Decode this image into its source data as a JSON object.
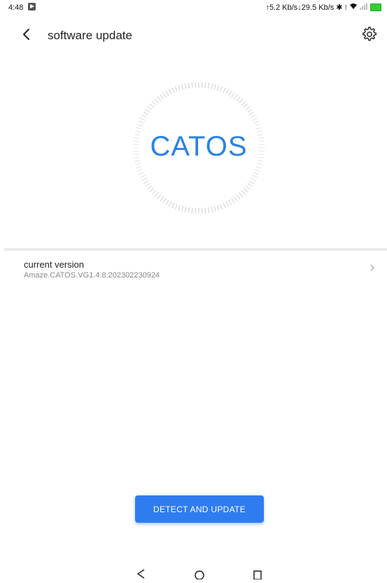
{
  "status_bar": {
    "time": "4:48",
    "network_speed": "↑5.2 Kb/s↓29.5 Kb/s",
    "icons": [
      "media-playing-icon",
      "bluetooth-icon",
      "vibrate-icon",
      "wifi-icon",
      "signal-icon",
      "battery-icon"
    ]
  },
  "header": {
    "title": "software update",
    "back_icon": "back-arrow-icon",
    "settings_icon": "gear-icon"
  },
  "logo": {
    "text": "CATOS",
    "color": "#2b82e6"
  },
  "current_version": {
    "label": "current version",
    "value": "Amaze.CATOS.VG1.4.8.202302230924"
  },
  "action": {
    "label": "DETECT AND UPDATE",
    "color": "#2f7cf0"
  },
  "nav_bar": {
    "icons": [
      "nav-back-icon",
      "nav-home-icon",
      "nav-recents-icon"
    ]
  }
}
